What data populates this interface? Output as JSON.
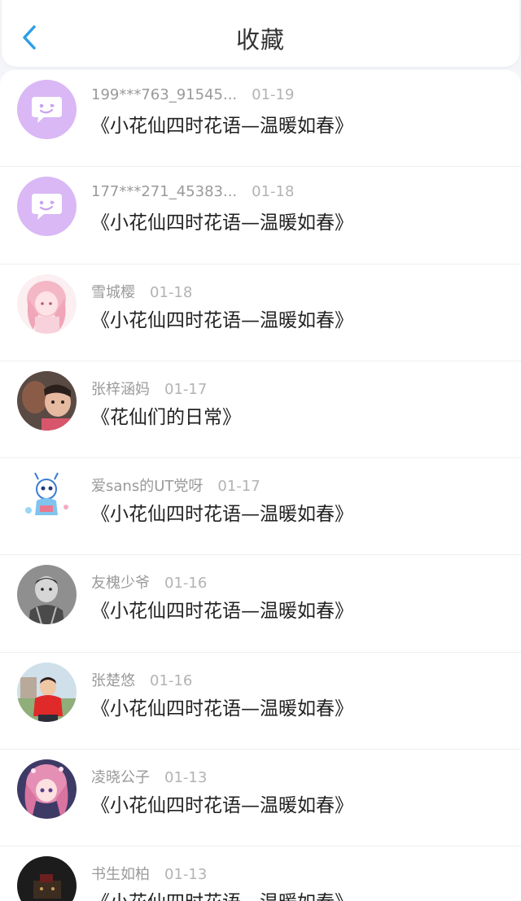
{
  "header": {
    "title": "收藏",
    "accent_color": "#2f9ee8"
  },
  "items": [
    {
      "user": "199***763_91545...",
      "date": "01-19",
      "work": "《小花仙四时花语—温暖如春》",
      "avatar": "default-chat-avatar"
    },
    {
      "user": "177***271_45383...",
      "date": "01-18",
      "work": "《小花仙四时花语—温暖如春》",
      "avatar": "default-chat-avatar"
    },
    {
      "user": "雪城樱",
      "date": "01-18",
      "work": "《小花仙四时花语—温暖如春》",
      "avatar": "anime-girl-pink"
    },
    {
      "user": "张梓涵妈",
      "date": "01-17",
      "work": "《花仙们的日常》",
      "avatar": "photo-child"
    },
    {
      "user": "爱sans的UT党呀",
      "date": "01-17",
      "work": "《小花仙四时花语—温暖如春》",
      "avatar": "cartoon-skeleton"
    },
    {
      "user": "友槐少爷",
      "date": "01-16",
      "work": "《小花仙四时花语—温暖如春》",
      "avatar": "photo-child-gray"
    },
    {
      "user": "张楚悠",
      "date": "01-16",
      "work": "《小花仙四时花语—温暖如春》",
      "avatar": "photo-child-red"
    },
    {
      "user": "凌晓公子",
      "date": "01-13",
      "work": "《小花仙四时花语—温暖如春》",
      "avatar": "anime-girl-pink-dark"
    },
    {
      "user": "书生如柏",
      "date": "01-13",
      "work": "《小花仙四时花语—温暖如春》",
      "avatar": "dark-photo"
    }
  ]
}
